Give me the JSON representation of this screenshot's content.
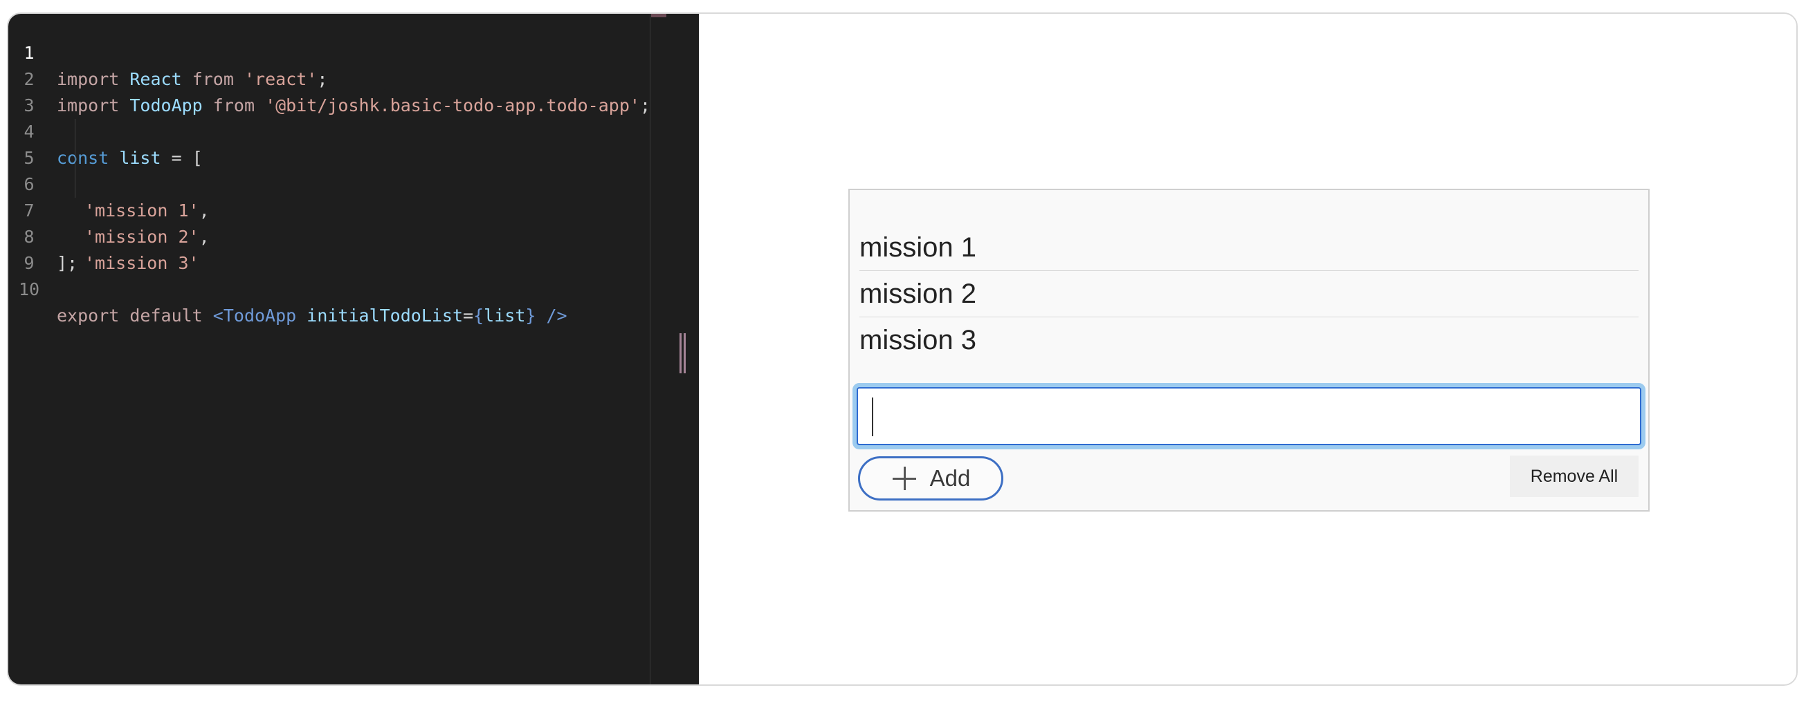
{
  "editor": {
    "lines": [
      {
        "n": "1",
        "active": true
      },
      {
        "n": "2"
      },
      {
        "n": "3"
      },
      {
        "n": "4"
      },
      {
        "n": "5"
      },
      {
        "n": "6"
      },
      {
        "n": "7"
      },
      {
        "n": "8"
      },
      {
        "n": "9"
      },
      {
        "n": "10"
      }
    ],
    "code": {
      "l1": {
        "kw": "import",
        "id": "React",
        "from": "from",
        "str": "'react'",
        "end": ";"
      },
      "l2": {
        "kw": "import",
        "id": "TodoApp",
        "from": "from",
        "str": "'@bit/joshk.basic-todo-app.todo-app'",
        "end": ";"
      },
      "l4": {
        "kw": "const",
        "id": "list",
        "rest": " = ["
      },
      "l5": {
        "str": "'mission 1'",
        "end": ","
      },
      "l6": {
        "str": "'mission 2'",
        "end": ","
      },
      "l7": {
        "str": "'mission 3'"
      },
      "l8": {
        "text": "];"
      },
      "l10": {
        "kw": "export default",
        "lt": "<",
        "tag": "TodoApp",
        "attr": "initialTodoList",
        "eq": "=",
        "ob": "{",
        "val": "list",
        "cb": "}",
        "close": " />"
      }
    }
  },
  "preview": {
    "todos": [
      "mission 1",
      "mission 2",
      "mission 3"
    ],
    "input": {
      "value": "",
      "placeholder": ""
    },
    "add_label": "Add",
    "remove_all_label": "Remove All"
  }
}
